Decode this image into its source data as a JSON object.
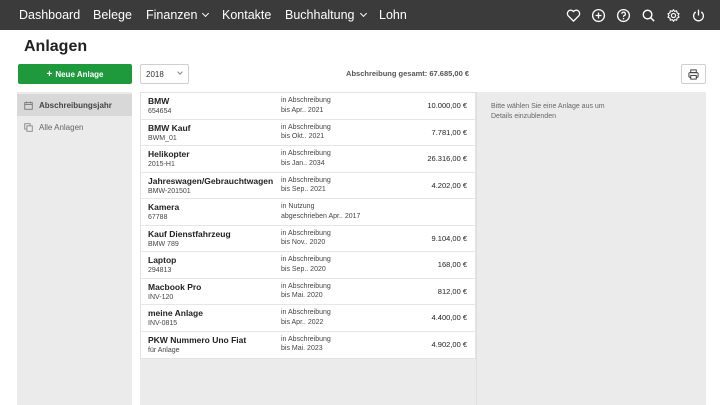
{
  "nav": {
    "items": [
      {
        "label": "Dashboard"
      },
      {
        "label": "Belege"
      },
      {
        "label": "Finanzen"
      },
      {
        "label": "Kontakte"
      },
      {
        "label": "Buchhaltung"
      },
      {
        "label": "Lohn"
      }
    ],
    "icons": [
      "heart-icon",
      "plus-circle-icon",
      "help-icon",
      "search-icon",
      "gear-icon",
      "power-icon"
    ]
  },
  "page": {
    "title": "Anlagen"
  },
  "toolbar": {
    "new_button_label": "Neue Anlage",
    "year_value": "2018",
    "total_label": "Abschreibung gesamt: 67.685,00 €"
  },
  "sidebar": {
    "items": [
      {
        "label": "Abschreibungsjahr",
        "icon": "calendar-icon",
        "active": true
      },
      {
        "label": "Alle Anlagen",
        "icon": "copy-icon",
        "active": false
      }
    ]
  },
  "assets": [
    {
      "name": "BMW",
      "code": "654654",
      "status1": "in Abschreibung",
      "status2": "bis Apr.. 2021",
      "amount": "10.000,00 €"
    },
    {
      "name": "BMW Kauf",
      "code": "BWM_01",
      "status1": "in Abschreibung",
      "status2": "bis Okt.. 2021",
      "amount": "7.781,00 €"
    },
    {
      "name": "Helikopter",
      "code": "2015-H1",
      "status1": "in Abschreibung",
      "status2": "bis Jan.. 2034",
      "amount": "26.316,00 €"
    },
    {
      "name": "Jahreswagen/Gebrauchtwagen",
      "code": "BMW-201501",
      "status1": "in Abschreibung",
      "status2": "bis Sep.. 2021",
      "amount": "4.202,00 €"
    },
    {
      "name": "Kamera",
      "code": "67788",
      "status1": "in Nutzung",
      "status2": "abgeschrieben Apr.. 2017",
      "amount": ""
    },
    {
      "name": "Kauf Dienstfahrzeug",
      "code": "BMW 789",
      "status1": "in Abschreibung",
      "status2": "bis Nov.. 2020",
      "amount": "9.104,00 €"
    },
    {
      "name": "Laptop",
      "code": "294813",
      "status1": "in Abschreibung",
      "status2": "bis Sep.. 2020",
      "amount": "168,00 €"
    },
    {
      "name": "Macbook Pro",
      "code": "INV-120",
      "status1": "in Abschreibung",
      "status2": "bis Mai. 2020",
      "amount": "812,00 €"
    },
    {
      "name": "meine Anlage",
      "code": "INV-0815",
      "status1": "in Abschreibung",
      "status2": "bis Apr.. 2022",
      "amount": "4.400,00 €"
    },
    {
      "name": "PKW Nummero Uno Fiat",
      "code": "für Anlage",
      "status1": "in Abschreibung",
      "status2": "bis Mai. 2023",
      "amount": "4.902,00 €"
    }
  ],
  "detail": {
    "hint": "Bitte wählen Sie eine Anlage aus um Details einzublenden"
  }
}
